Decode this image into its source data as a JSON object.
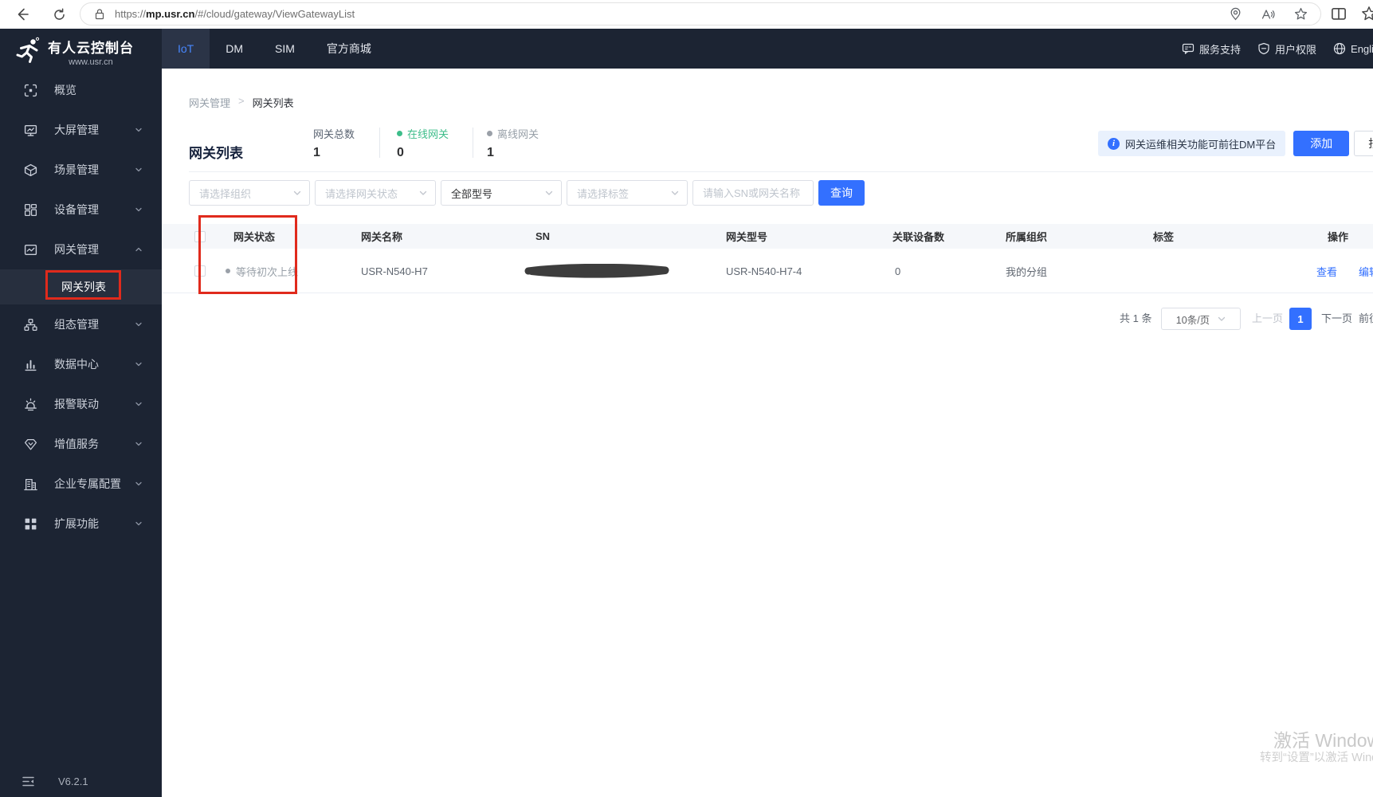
{
  "browser": {
    "url": {
      "scheme": "https://",
      "host": "mp.usr.cn",
      "path": "/#/cloud/gateway/ViewGatewayList"
    }
  },
  "topnav": {
    "tabs": {
      "iot": "IoT",
      "dm": "DM",
      "sim": "SIM",
      "mall": "官方商城"
    },
    "support_label": "服务支持",
    "permission_label": "用户权限",
    "language_label": "English"
  },
  "sidebar": {
    "brand_title": "有人云控制台",
    "brand_site": "www.usr.cn",
    "version": "V6.2.1",
    "items": [
      {
        "label": "概览"
      },
      {
        "label": "大屏管理"
      },
      {
        "label": "场景管理"
      },
      {
        "label": "设备管理"
      },
      {
        "label": "网关管理"
      },
      {
        "label": "组态管理"
      },
      {
        "label": "数据中心"
      },
      {
        "label": "报警联动"
      },
      {
        "label": "增值服务"
      },
      {
        "label": "企业专属配置"
      },
      {
        "label": "扩展功能"
      }
    ],
    "active_item": "网关管理",
    "active_submenu": "网关列表"
  },
  "breadcrumb": {
    "parent": "网关管理",
    "separator": ">",
    "current": "网关列表"
  },
  "header": {
    "title": "网关列表",
    "stats": {
      "total_label": "网关总数",
      "total_value": "1",
      "online_label": "在线网关",
      "online_value": "0",
      "offline_label": "离线网关",
      "offline_value": "1"
    },
    "notice": "网关运维相关功能可前往DM平台",
    "add_button": "添加",
    "batch_button": "批量"
  },
  "filters": {
    "org_placeholder": "请选择组织",
    "status_placeholder": "请选择网关状态",
    "model_value": "全部型号",
    "tag_placeholder": "请选择标签",
    "search_placeholder": "请输入SN或网关名称",
    "query_button": "查询"
  },
  "table": {
    "columns": [
      "网关状态",
      "网关名称",
      "SN",
      "网关型号",
      "关联设备数",
      "所属组织",
      "标签",
      "操作"
    ],
    "row": {
      "status": "等待初次上线",
      "name": "USR-N540-H7",
      "sn_redacted": true,
      "model": "USR-N540-H7-4",
      "linked_devices": "0",
      "organization": "我的分组",
      "tag": "",
      "action_view": "查看",
      "action_edit": "编辑"
    }
  },
  "pagination": {
    "total": "共 1 条",
    "page_size": "10条/页",
    "prev": "上一页",
    "page": "1",
    "next": "下一页",
    "jump": "前往"
  },
  "watermark": {
    "line1": "激活 Windows",
    "line2": "转到“设置”以激活 Windows。"
  },
  "colors": {
    "accent_blue": "#3370ff",
    "dark_bg": "#1c2433",
    "online_green": "#3dbd8a",
    "offline_gray": "#909399",
    "annotation_red": "#e02a1c"
  }
}
